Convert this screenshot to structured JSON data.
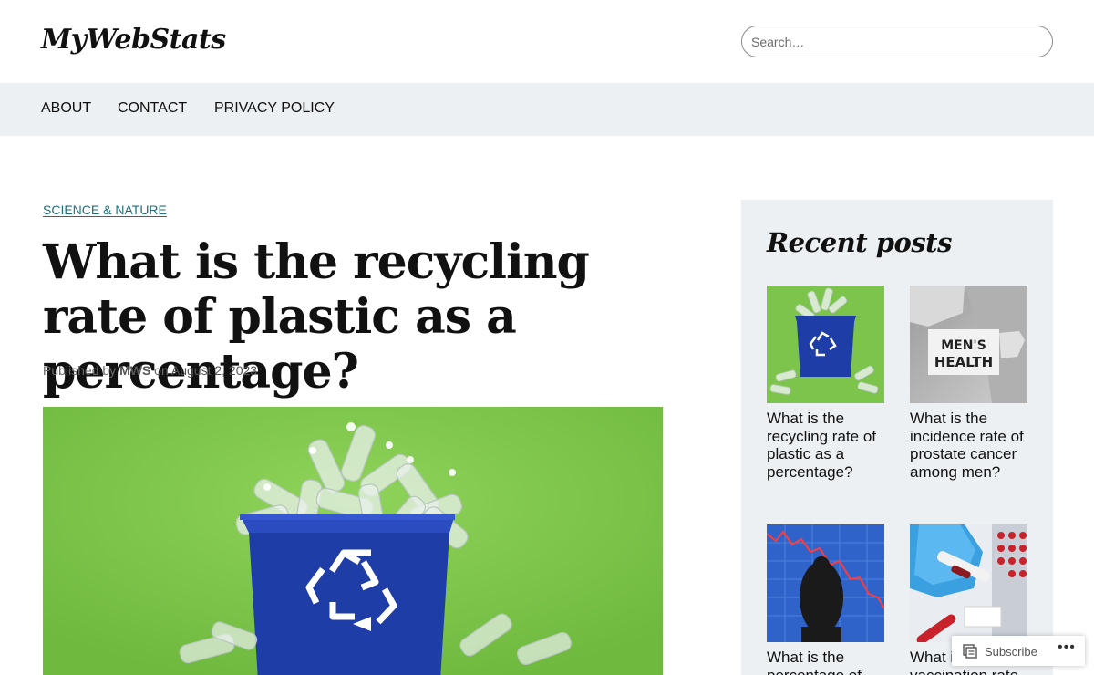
{
  "site": {
    "title": "MyWebStats"
  },
  "search": {
    "placeholder": "Search…"
  },
  "nav": {
    "items": [
      {
        "label": "ABOUT"
      },
      {
        "label": "CONTACT"
      },
      {
        "label": "PRIVACY POLICY"
      }
    ]
  },
  "post": {
    "category": "SCIENCE & NATURE",
    "title": "What is the recycling rate of plastic as a percentage?",
    "byline": {
      "prefix": "Published by",
      "author": "MWS",
      "on": "on",
      "date": "August 2, 2023"
    },
    "image": {
      "description": "blue recycling bin filled with plastic bottles",
      "icon": "recycle-icon"
    }
  },
  "sidebar": {
    "title": "Recent posts",
    "posts": [
      {
        "title": "What is the recycling rate of plastic as a percentage?",
        "thumb": "recycling-bin"
      },
      {
        "title": "What is the incidence rate of prostate cancer among men?",
        "thumb": "mens-health",
        "thumb_text": "MEN'S HEALTH"
      },
      {
        "title": "What is the percentage of",
        "thumb": "falling-chart"
      },
      {
        "title": "What is the vaccination rate",
        "thumb": "vaccine-vial"
      }
    ]
  },
  "footer_bar": {
    "subscribe_label": "Subscribe",
    "more_label": "•••"
  },
  "colors": {
    "nav_bg": "#edf0f3",
    "category": "#1e6f7e",
    "image_green": "#7cc44b",
    "bin_blue": "#1f3da6"
  }
}
